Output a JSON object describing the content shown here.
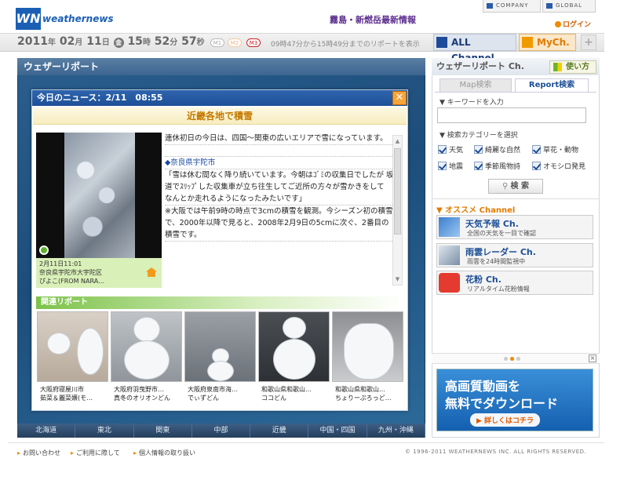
{
  "header": {
    "logo_mark": "WN",
    "logo_text": "weathernews",
    "headline": "霧島・新燃岳最新情報",
    "company": "COMPANY",
    "global": "GLOBAL",
    "login": "ログイン"
  },
  "timebar": {
    "year": "2011",
    "year_unit": "年",
    "month": "02",
    "month_unit": "月",
    "day": "11",
    "day_unit": "日",
    "weekday": "金",
    "hour": "15",
    "hour_unit": "時",
    "minute": "52",
    "minute_unit": "分",
    "second": "57",
    "second_unit": "秒",
    "m1": "M1",
    "m2": "M2",
    "m3": "M3",
    "info": "09時47分から15時49分までのリポートを表示",
    "all_channel": "ALL Channel",
    "my_channel": "MyCh.",
    "plus": "+"
  },
  "map": {
    "title": "ウェザーリポート",
    "regions": [
      "北海道",
      "東北",
      "関東",
      "中部",
      "近畿",
      "中国・四国",
      "九州・沖縄"
    ]
  },
  "modal": {
    "header": "今日のニュース：2/11　08:55",
    "close": "✕",
    "news_title": "近畿各地で積雪",
    "caption_date": "2月11日11:01",
    "caption_place": "奈良県宇陀市大宇陀区",
    "caption_user": "ぴよこ(FROM NARA…",
    "article": {
      "intro": "連休初日の今日は、四国～関東の広いエリアで雪になっています。",
      "place": "◆奈良県宇陀市",
      "quote": "「雪は休む間なく降り続いています。今朝はｺﾞﾐの収集日でしたが 坂道でｽﾘｯﾌﾟした収集車が立ち往生してご近所の方々が雪かきをして なんとか走れるようになったみたいです」",
      "note": "※大阪では午前9時の時点で3cmの積雪を観測。今シーズン初の積雪で、2000年以降で見ると、2008年2月9日の5cmに次ぐ、2番目の積雪です。"
    },
    "related_title": "関連リポート",
    "related": [
      {
        "place": "大阪府寝屋川市",
        "user": "茹菜＆麗菜嬢(モ…"
      },
      {
        "place": "大阪府羽曳野市…",
        "user": "真冬のオリオンどん"
      },
      {
        "place": "大阪府泉南市海…",
        "user": "でぃずどん"
      },
      {
        "place": "和歌山県和歌山…",
        "user": "ココどん"
      },
      {
        "place": "和歌山県和歌山…",
        "user": "ちょりーぷろっど…"
      }
    ]
  },
  "right": {
    "title": "ウェザーリポート Ch.",
    "usage": "使い方",
    "tab_map": "Map検索",
    "tab_report": "Report検索",
    "keyword_label": "▼ キーワードを入力",
    "keyword_value": "",
    "category_label": "▼ 検索カテゴリーを選択",
    "categories": [
      "天気",
      "綺麗な自然",
      "草花・動物",
      "地震",
      "季節風物詩",
      "オモシロ発見"
    ],
    "search_button": "検 索",
    "recommend": "▼ オススメ Channel",
    "channels": [
      {
        "name": "天気予報 Ch.",
        "desc": "全国の天気を一目で確認"
      },
      {
        "name": "雨雲レーダー Ch.",
        "desc": "雨雲を24時間監視中"
      },
      {
        "name": "花粉 Ch.",
        "desc": "リアルタイム花粉情報"
      }
    ],
    "banner_line1": "高画質動画を",
    "banner_line2": "無料でダウンロード",
    "banner_button": "▶ 詳しくはコチラ"
  },
  "footer": {
    "links": [
      "お問い合わせ",
      "ご利用に際して",
      "個人情報の取り扱い"
    ],
    "copyright": "© 1996-2011 WEATHERNEWS INC. ALL RIGHTS RESERVED."
  }
}
